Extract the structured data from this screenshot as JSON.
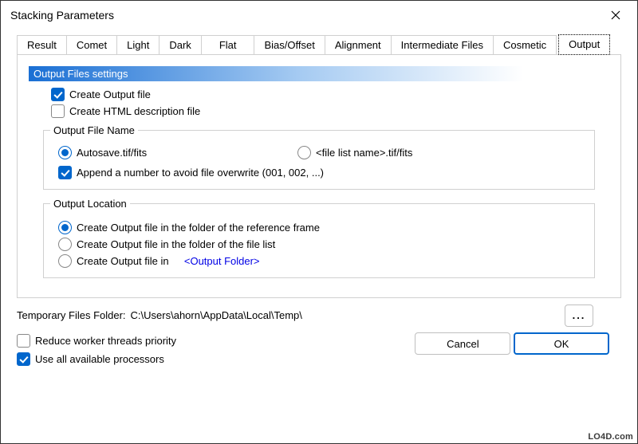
{
  "window": {
    "title": "Stacking Parameters"
  },
  "tabs": {
    "items": [
      {
        "label": "Result"
      },
      {
        "label": "Comet"
      },
      {
        "label": "Light"
      },
      {
        "label": "Dark"
      },
      {
        "label": "Flat"
      },
      {
        "label": "Bias/Offset"
      },
      {
        "label": "Alignment"
      },
      {
        "label": "Intermediate Files"
      },
      {
        "label": "Cosmetic"
      },
      {
        "label": "Output"
      }
    ],
    "active": "Output"
  },
  "section": {
    "title": "Output Files settings"
  },
  "create_output": {
    "label": "Create Output file",
    "checked": true
  },
  "create_html": {
    "label": "Create HTML description file",
    "checked": false
  },
  "filename_group": {
    "legend": "Output File Name",
    "autosave": {
      "label": "Autosave.tif/fits",
      "checked": true
    },
    "listname": {
      "label": "<file list name>.tif/fits",
      "checked": false
    },
    "append": {
      "label": "Append a number to avoid file overwrite (001, 002, ...)",
      "checked": true
    }
  },
  "location_group": {
    "legend": "Output Location",
    "ref": {
      "label": "Create Output file in the folder of the reference frame",
      "checked": true
    },
    "list": {
      "label": "Create Output file in the folder of the file list",
      "checked": false
    },
    "custom": {
      "label": "Create Output file in",
      "checked": false
    },
    "folder_link": "<Output Folder>"
  },
  "temp": {
    "label": "Temporary Files Folder:",
    "path": "C:\\Users\\ahorn\\AppData\\Local\\Temp\\",
    "browse": "..."
  },
  "reduce_priority": {
    "label": "Reduce worker threads priority",
    "checked": false
  },
  "use_all_procs": {
    "label": "Use all available processors",
    "checked": true
  },
  "buttons": {
    "cancel": "Cancel",
    "ok": "OK"
  },
  "watermark": "LO4D.com"
}
